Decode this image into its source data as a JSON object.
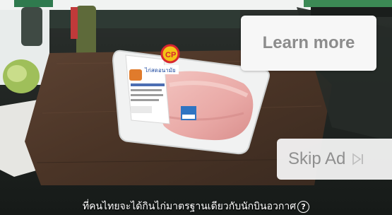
{
  "video": {
    "product_brand": "CP",
    "product_name": "ไก่สดอนามัย"
  },
  "ad_controls": {
    "learn_more_label": "Learn more",
    "skip_ad_label": "Skip Ad",
    "skip_icon": "skip-next-icon"
  },
  "caption": {
    "text": "ที่คนไทยจะได้กินไก่มาตรฐานเดียวกับนักบินอวกาศ",
    "help_icon": "question-circle-icon"
  },
  "colors": {
    "button_bg": "#f7f7f7",
    "button_text": "#8c8c8c",
    "brand_red": "#d8262f",
    "brand_yellow": "#f3c316"
  }
}
